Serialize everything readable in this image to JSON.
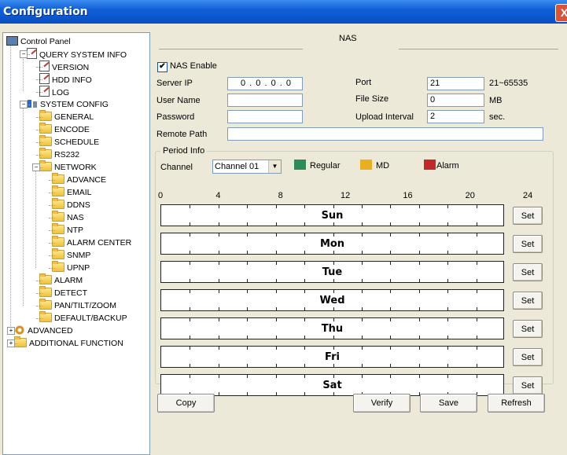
{
  "window": {
    "title": "Configuration",
    "close_label": "X"
  },
  "tree": {
    "items": [
      {
        "label": "Control Panel",
        "icon": "monitor-icon"
      },
      {
        "label": "QUERY SYSTEM INFO",
        "icon": "document-icon"
      },
      {
        "label": "VERSION",
        "icon": "document-icon"
      },
      {
        "label": "HDD INFO",
        "icon": "document-icon"
      },
      {
        "label": "LOG",
        "icon": "document-icon"
      },
      {
        "label": "SYSTEM CONFIG",
        "icon": "config-icon"
      },
      {
        "label": "GENERAL",
        "icon": "folder-icon"
      },
      {
        "label": "ENCODE",
        "icon": "folder-icon"
      },
      {
        "label": "SCHEDULE",
        "icon": "folder-icon"
      },
      {
        "label": "RS232",
        "icon": "folder-icon"
      },
      {
        "label": "NETWORK",
        "icon": "folder-icon"
      },
      {
        "label": "ADVANCE",
        "icon": "folder-icon"
      },
      {
        "label": "EMAIL",
        "icon": "folder-icon"
      },
      {
        "label": "DDNS",
        "icon": "folder-icon"
      },
      {
        "label": "NAS",
        "icon": "folder-icon"
      },
      {
        "label": "NTP",
        "icon": "folder-icon"
      },
      {
        "label": "ALARM CENTER",
        "icon": "folder-icon"
      },
      {
        "label": "SNMP",
        "icon": "folder-icon"
      },
      {
        "label": "UPNP",
        "icon": "folder-icon"
      },
      {
        "label": "ALARM",
        "icon": "folder-icon"
      },
      {
        "label": "DETECT",
        "icon": "folder-icon"
      },
      {
        "label": "PAN/TILT/ZOOM",
        "icon": "folder-icon"
      },
      {
        "label": "DEFAULT/BACKUP",
        "icon": "folder-icon"
      },
      {
        "label": "ADVANCED",
        "icon": "gear-icon"
      },
      {
        "label": "ADDITIONAL FUNCTION",
        "icon": "folder-icon"
      }
    ]
  },
  "nas": {
    "section_title": "NAS",
    "enable_label": "NAS Enable",
    "enable_checked": "✔",
    "server_ip_label": "Server IP",
    "server_ip_value": "0 . 0 . 0 . 0",
    "port_label": "Port",
    "port_value": "21",
    "port_range": "21~65535",
    "username_label": "User Name",
    "username_value": "",
    "filesize_label": "File Size",
    "filesize_value": "0",
    "filesize_unit": "MB",
    "password_label": "Password",
    "password_value": "",
    "upload_interval_label": "Upload Interval",
    "upload_interval_value": "2",
    "upload_interval_unit": "sec.",
    "remote_path_label": "Remote Path",
    "remote_path_value": ""
  },
  "period": {
    "group_title": "Period Info",
    "channel_label": "Channel",
    "channel_value": "Channel 01",
    "legend": [
      {
        "label": "Regular",
        "color": "#2e8b57"
      },
      {
        "label": "MD",
        "color": "#e8b020"
      },
      {
        "label": "Alarm",
        "color": "#c0282a"
      }
    ],
    "hours": [
      "0",
      "4",
      "8",
      "12",
      "16",
      "20",
      "24"
    ],
    "days": [
      "Sun",
      "Mon",
      "Tue",
      "Wed",
      "Thu",
      "Fri",
      "Sat"
    ],
    "set_label": "Set"
  },
  "buttons": {
    "copy": "Copy",
    "verify": "Verify",
    "save": "Save",
    "refresh": "Refresh"
  }
}
